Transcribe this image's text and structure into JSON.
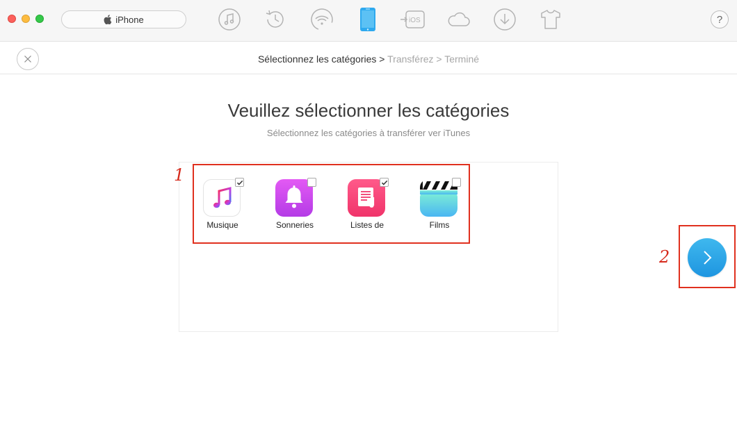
{
  "window": {
    "device_name": "iPhone",
    "help_label": "?",
    "toolbar_icons": [
      "music-icon",
      "history-icon",
      "wifi-icon",
      "phone-icon",
      "ios-transfer-icon",
      "cloud-icon",
      "download-icon",
      "tshirt-icon"
    ],
    "active_tool": "phone-icon"
  },
  "breadcrumb": {
    "step1": "Sélectionnez les catégories",
    "sep": ">",
    "step2": "Transférez",
    "step3": "Terminé"
  },
  "main": {
    "heading": "Veuillez sélectionner les catégories",
    "subheading": "Sélectionnez les catégories à transférer ver iTunes"
  },
  "categories": [
    {
      "label": "Musique",
      "checked": true,
      "icon": "music-note-icon"
    },
    {
      "label": "Sonneries",
      "checked": false,
      "icon": "bell-icon"
    },
    {
      "label": "Listes de",
      "checked": true,
      "icon": "playlist-icon"
    },
    {
      "label": "Films",
      "checked": false,
      "icon": "clapperboard-icon"
    }
  ],
  "annotations": {
    "step1": "1",
    "step2": "2"
  },
  "colors": {
    "accent": "#2aa7ea",
    "annotation_red": "#e0301e",
    "active_tool": "#2ea9ee"
  }
}
